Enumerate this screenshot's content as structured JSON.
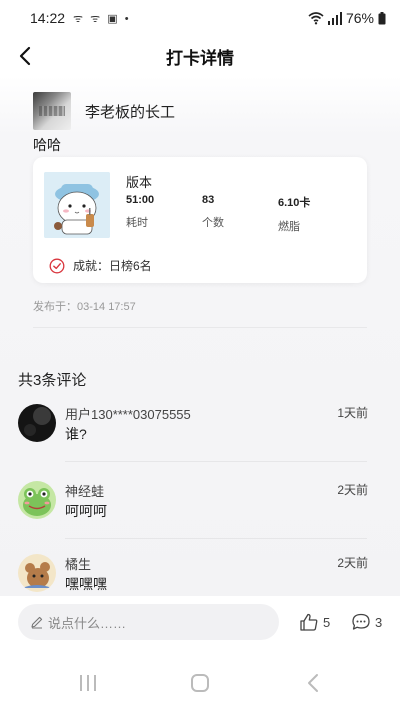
{
  "status_bar": {
    "time": "14:22",
    "notification_icons": "ᯤ ᯤ ▣ •",
    "battery": "76%"
  },
  "header": {
    "title": "打卡详情"
  },
  "post": {
    "username": "李老板的长工",
    "text": "哈哈",
    "card": {
      "title": "版本",
      "stats": [
        {
          "value": "51:00",
          "label": "耗时"
        },
        {
          "value": "83",
          "label": "个数"
        },
        {
          "value": "6.10卡",
          "label": "燃脂"
        }
      ],
      "achievement": "成就：日榜6名"
    },
    "published": "发布于：03-14 17:57"
  },
  "comments": {
    "title": "共3条评论",
    "items": [
      {
        "user": "用户130****03075555",
        "time": "1天前",
        "text": "谁?"
      },
      {
        "user": "神经蛙",
        "time": "2天前",
        "text": "呵呵呵"
      },
      {
        "user": "橘生",
        "time": "2天前",
        "text": "嘿嘿嘿"
      }
    ]
  },
  "bottom_bar": {
    "input_placeholder": "说点什么……",
    "likes": "5",
    "comment_count": "3"
  },
  "colors": {
    "accent_red": "#d9363e",
    "text_primary": "#222222",
    "text_muted": "#999999"
  },
  "icons": [
    "back-arrow-icon",
    "wifi-icon",
    "signal-icon",
    "battery-icon",
    "achievement-check-icon",
    "pencil-icon",
    "thumbs-up-icon",
    "comment-bubble-icon",
    "recent-apps-icon",
    "home-icon",
    "back-nav-icon"
  ]
}
